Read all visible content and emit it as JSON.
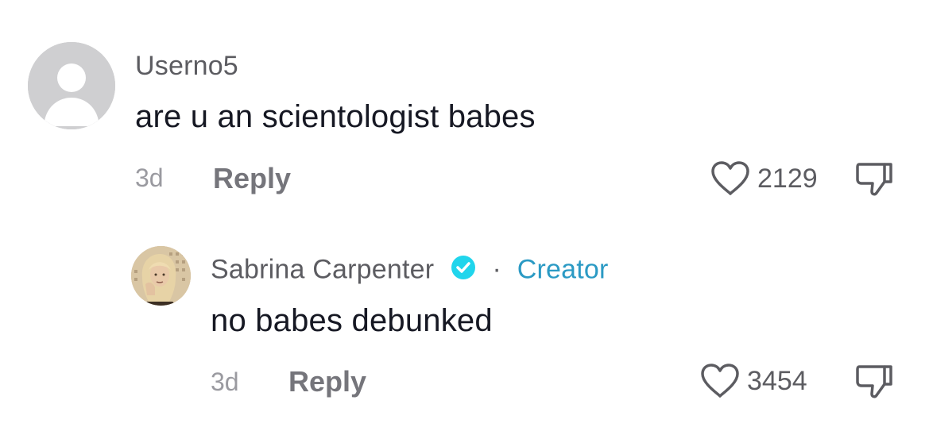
{
  "comments": [
    {
      "username": "Userno5",
      "text": "are u an scientologist babes",
      "age": "3d",
      "reply_label": "Reply",
      "likes": "2129",
      "avatar_icon": "default-avatar-icon"
    }
  ],
  "replies": [
    {
      "username": "Sabrina Carpenter",
      "verified": true,
      "separator": "·",
      "badge": "Creator",
      "text": "no babes debunked",
      "age": "3d",
      "reply_label": "Reply",
      "likes": "3454",
      "avatar_icon": "profile-photo-avatar"
    }
  ],
  "colors": {
    "primary_text": "#161823",
    "secondary_text": "#5c5c61",
    "muted_text": "#9a9aa0",
    "creator_badge": "#2b9ac4",
    "verified_badge": "#20d5ec"
  }
}
